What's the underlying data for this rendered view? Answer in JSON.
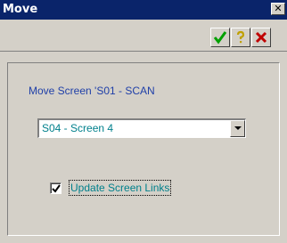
{
  "window": {
    "title": "Move",
    "close_glyph": "✕"
  },
  "toolbar": {
    "buttons": [
      {
        "name": "ok",
        "icon": "checkmark-icon",
        "color": "#00a000"
      },
      {
        "name": "help",
        "icon": "question-icon",
        "color": "#c0a000"
      },
      {
        "name": "cancel",
        "icon": "cross-icon",
        "color": "#c00000"
      }
    ]
  },
  "form": {
    "move_label": "Move Screen 'S01 - SCAN",
    "screen_select": {
      "selected": "S04 - Screen 4"
    },
    "update_links": {
      "label": "Update Screen Links",
      "checked": true
    }
  },
  "colors": {
    "titlebar": "#0a246a",
    "face": "#d4d0c8",
    "label_blue": "#1f3fa8",
    "value_teal": "#00808c"
  }
}
